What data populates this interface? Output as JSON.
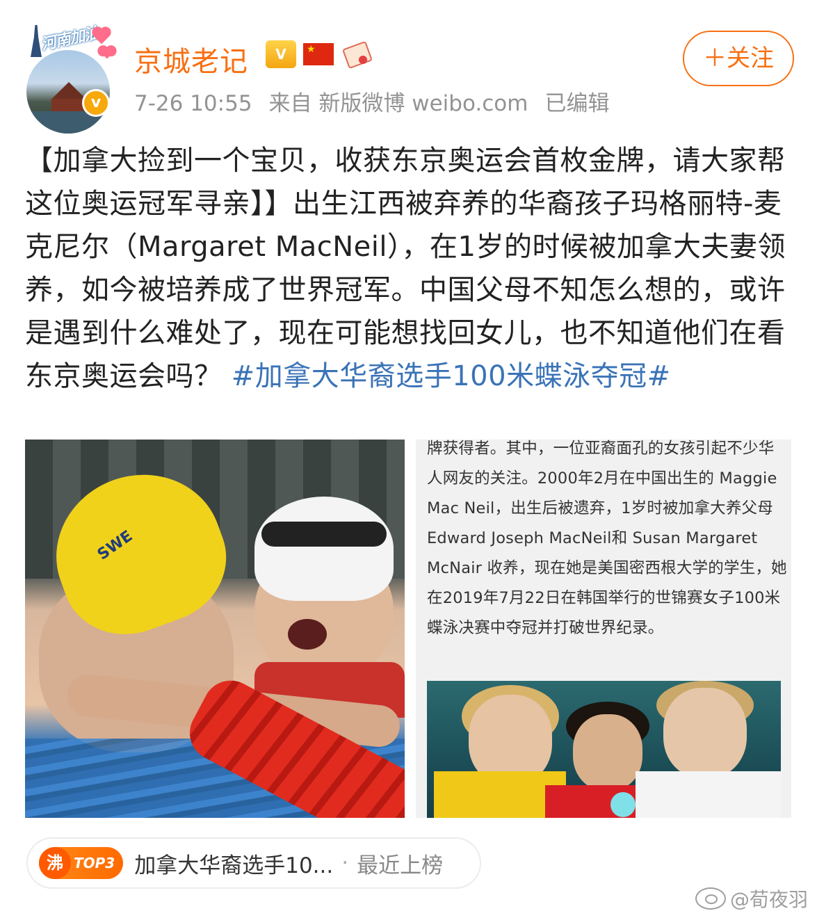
{
  "header": {
    "avatar_banner_text": "河南加油",
    "verified_mark": "v",
    "username": "京城老记",
    "badges": [
      "crown-badge-icon",
      "china-flag-icon",
      "scroll-badge-icon"
    ],
    "time": "7-26 10:55",
    "source": "来自 新版微博 weibo.com",
    "edited": "已编辑",
    "follow_label": "＋关注"
  },
  "post": {
    "text": "【加拿大捡到一个宝贝，收获东京奥运会首枚金牌，请大家帮这位奥运冠军寻亲】】出生江西被弃养的华裔孩子玛格丽特-麦克尼尔（Margaret MacNeil），在1岁的时候被加拿大夫妻领养，如今被培养成了世界冠军。中国父母不知怎么想的，或许是遇到什么难处了，现在可能想找回女儿，也不知道他们在看东京奥运会吗？",
    "hashtag": "#加拿大华裔选手100米蝶泳夺冠#"
  },
  "images": {
    "left": {
      "cap_text": "SWE"
    },
    "right": {
      "snippet": "牌获得者。其中，一位亚裔面孔的女孩引起不少华人网友的关注。2000年2月在中国出生的 Maggie Mac Neil，出生后被遗弃，1岁时被加拿大养父母Edward Joseph MacNeil和 Susan Margaret McNair 收养，现在她是美国密西根大学的学生，她在2019年7月22日在韩国举行的世锦赛女子100米 蝶泳决赛中夺冠并打破世界纪录。"
    }
  },
  "topic": {
    "icon_text": "沸",
    "rank": "TOP3",
    "title": "加拿大华裔选手10...",
    "separator": "·",
    "status": "最近上榜"
  },
  "watermark": {
    "text": "@荀夜羽"
  },
  "colors": {
    "username": "#f86f12",
    "hashtag": "#3a73b7",
    "meta": "#939393",
    "follow": "#f86f12"
  }
}
